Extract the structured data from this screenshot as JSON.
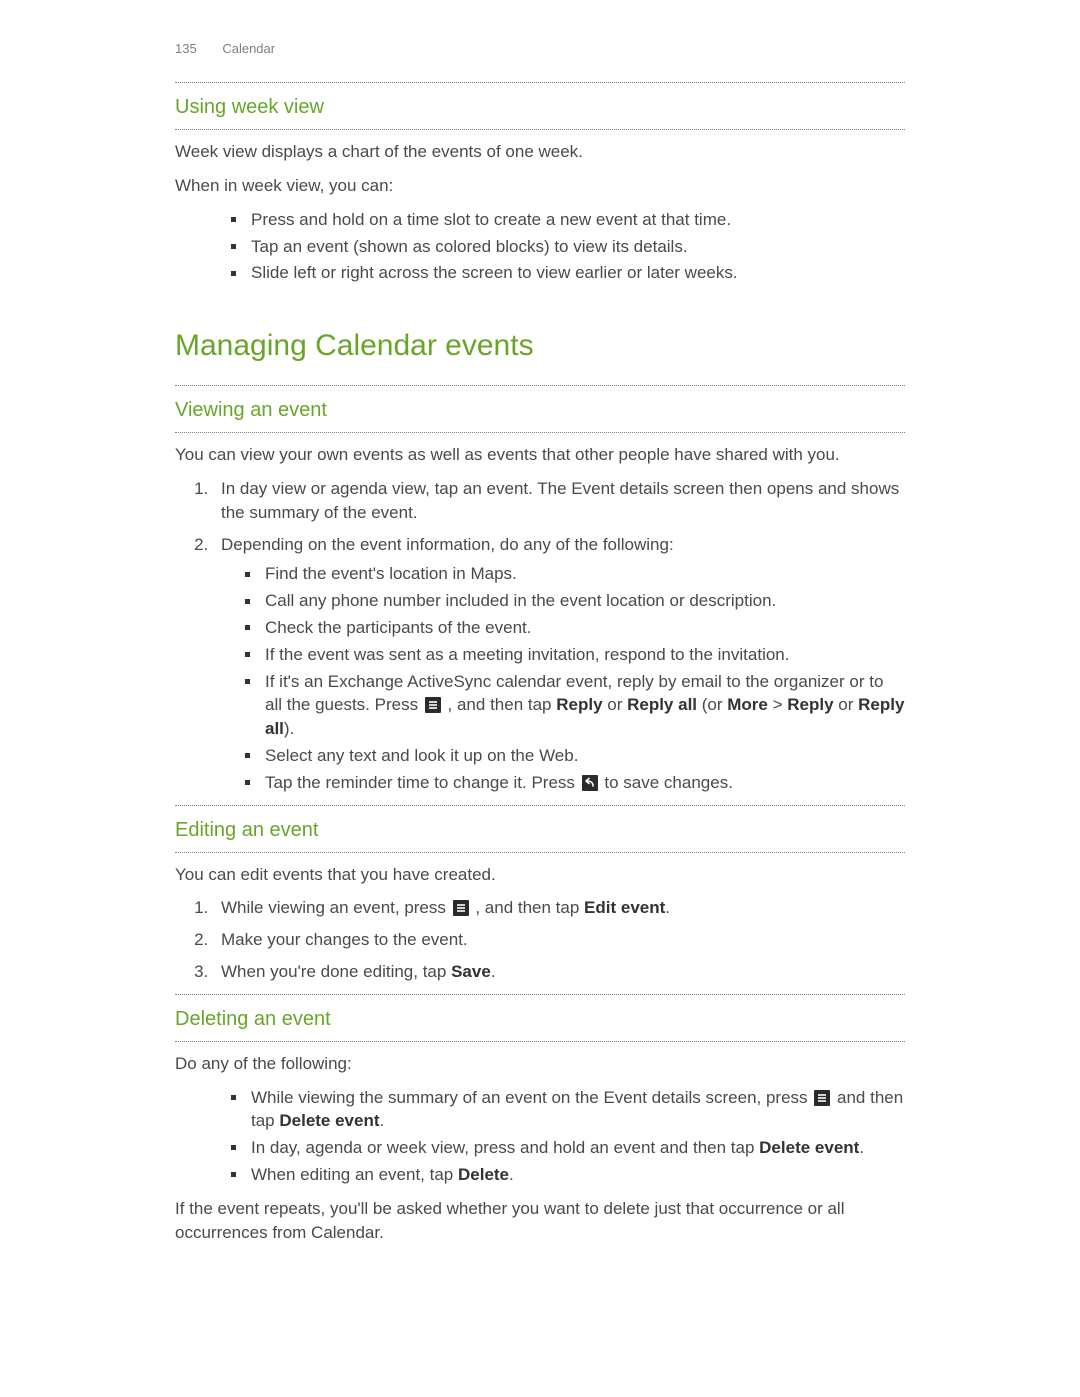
{
  "header": {
    "page_number": "135",
    "section": "Calendar"
  },
  "week": {
    "heading": "Using week view",
    "p1": "Week view displays a chart of the events of one week.",
    "p2": "When in week view, you can:",
    "bullets": [
      "Press and hold on a time slot to create a new event at that time.",
      "Tap an event (shown as colored blocks) to view its details.",
      "Slide left or right across the screen to view earlier or later weeks."
    ]
  },
  "managing": {
    "heading": "Managing Calendar events"
  },
  "viewing": {
    "heading": "Viewing an event",
    "intro": "You can view your own events as well as events that other people have shared with you.",
    "step1": "In day view or agenda view, tap an event. The Event details screen then opens and shows the summary of the event.",
    "step2_lead": "Depending on the event information, do any of the following:",
    "step2_bullets": {
      "b1": "Find the event's location in Maps.",
      "b2": "Call any phone number included in the event location or description.",
      "b3": "Check the participants of the event.",
      "b4": "If the event was sent as a meeting invitation, respond to the invitation.",
      "b5a": "If it's an Exchange ActiveSync calendar event, reply by email to the organizer or to all the guests. Press ",
      "b5b": " , and then tap ",
      "b5_reply": "Reply",
      "b5_or1": " or ",
      "b5_replyall": "Reply all",
      "b5_c": " (or ",
      "b5_more": "More",
      "b5_gt": " > ",
      "b5_reply2": "Reply",
      "b5_or2": " or ",
      "b5_replyall2": "Reply all",
      "b5_end": ").",
      "b6": "Select any text and look it up on the Web.",
      "b7a": "Tap the reminder time to change it. Press ",
      "b7b": " to save changes."
    }
  },
  "editing": {
    "heading": "Editing an event",
    "intro": "You can edit events that you have created.",
    "step1a": "While viewing an event, press ",
    "step1b": " , and then tap ",
    "step1_edit": "Edit event",
    "step1_end": ".",
    "step2": "Make your changes to the event.",
    "step3a": "When you're done editing, tap ",
    "step3_save": "Save",
    "step3_end": "."
  },
  "deleting": {
    "heading": "Deleting an event",
    "intro": "Do any of the following:",
    "b1a": "While viewing the summary of an event on the Event details screen, press ",
    "b1b": " and then tap ",
    "b1_delete": "Delete event",
    "b1_end": ".",
    "b2a": "In day, agenda or week view, press and hold an event and then tap ",
    "b2_delete": "Delete event",
    "b2_end": ".",
    "b3a": "When editing an event, tap ",
    "b3_delete": "Delete",
    "b3_end": ".",
    "outro": "If the event repeats, you'll be asked whether you want to delete just that occurrence or all occurrences from Calendar."
  }
}
